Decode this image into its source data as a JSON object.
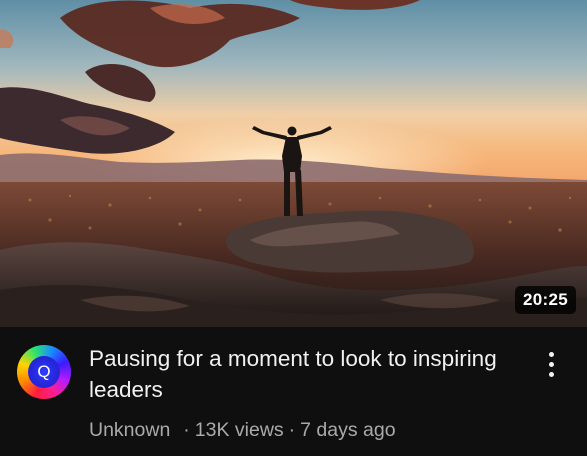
{
  "video": {
    "title": "Pausing for a moment to look to inspiring leaders",
    "duration": "20:25",
    "channel": "Unknown",
    "views": "13K views",
    "age": "7 days ago",
    "separator": "·",
    "avatar_letter": "Q"
  },
  "icons": {
    "menu": "more-vert-icon"
  }
}
